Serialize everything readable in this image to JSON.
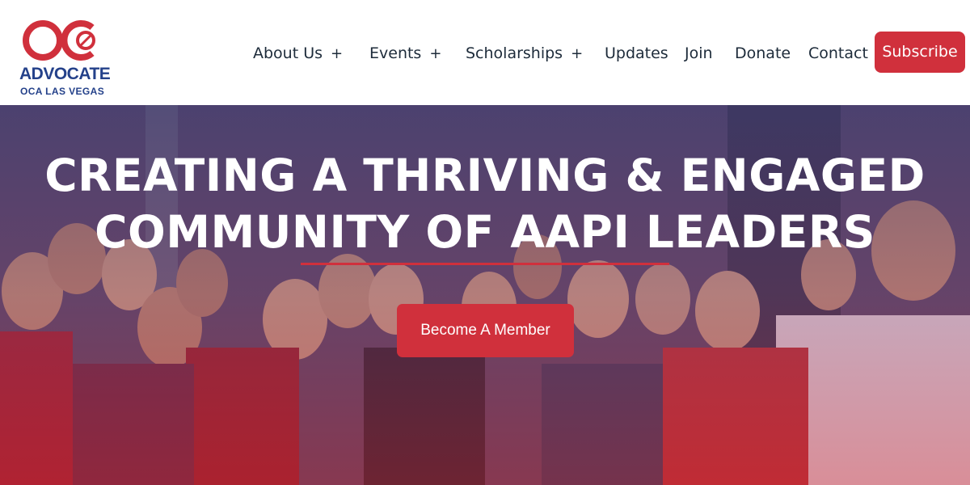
{
  "logo": {
    "word": "ADVOCATE",
    "sub": "OCA LAS VEGAS",
    "colors": {
      "red": "#d0303c",
      "blue": "#24418a"
    }
  },
  "nav": {
    "items": [
      {
        "label": "About Us",
        "submenu_icon": "+"
      },
      {
        "label": "Events",
        "submenu_icon": "+"
      },
      {
        "label": "Scholarships",
        "submenu_icon": "+"
      },
      {
        "label": "Updates"
      },
      {
        "label": "Join"
      },
      {
        "label": "Donate"
      },
      {
        "label": "Contact"
      }
    ],
    "subscribe_label": "Subscribe"
  },
  "hero": {
    "headline_line1": "CREATING A THRIVING & ENGAGED",
    "headline_line2": "COMMUNITY OF AAPI LEADERS",
    "cta_label": "Become A Member",
    "background": "group-photo"
  },
  "colors": {
    "accent": "#d0303c",
    "nav_text": "#1d2b3a",
    "overlay_top": "#463e74",
    "overlay_bottom": "#c4242e"
  }
}
